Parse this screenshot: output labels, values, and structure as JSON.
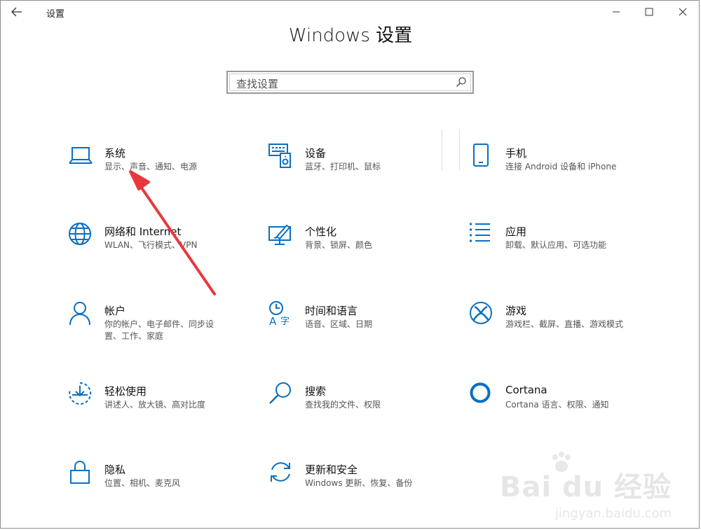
{
  "window": {
    "title": "设置"
  },
  "page": {
    "heading": "Windows 设置"
  },
  "search": {
    "placeholder": "查找设置"
  },
  "tiles": [
    {
      "id": "system",
      "title": "系统",
      "desc": "显示、声音、通知、电源"
    },
    {
      "id": "devices",
      "title": "设备",
      "desc": "蓝牙、打印机、鼠标"
    },
    {
      "id": "phone",
      "title": "手机",
      "desc": "连接 Android 设备和 iPhone"
    },
    {
      "id": "network",
      "title": "网络和 Internet",
      "desc": "WLAN、飞行模式、VPN"
    },
    {
      "id": "personalization",
      "title": "个性化",
      "desc": "背景、锁屏、颜色"
    },
    {
      "id": "apps",
      "title": "应用",
      "desc": "卸载、默认应用、可选功能"
    },
    {
      "id": "accounts",
      "title": "帐户",
      "desc": "你的帐户、电子邮件、同步设置、工作、家庭"
    },
    {
      "id": "time-language",
      "title": "时间和语言",
      "desc": "语音、区域、日期"
    },
    {
      "id": "gaming",
      "title": "游戏",
      "desc": "游戏栏、截屏、直播、游戏模式"
    },
    {
      "id": "ease-of-access",
      "title": "轻松使用",
      "desc": "讲述人、放大镜、高对比度"
    },
    {
      "id": "search",
      "title": "搜索",
      "desc": "查找我的文件、权限"
    },
    {
      "id": "cortana",
      "title": "Cortana",
      "desc": "Cortana 语言、权限、通知"
    },
    {
      "id": "privacy",
      "title": "隐私",
      "desc": "位置、相机、麦克风"
    },
    {
      "id": "update-security",
      "title": "更新和安全",
      "desc": "Windows 更新、恢复、备份"
    }
  ],
  "watermark": {
    "main": "Bai du 经验",
    "sub": "jingyan.baidu.com"
  },
  "colors": {
    "accent": "#0a6fc2",
    "annotation_arrow": "#e8383d"
  },
  "icons": {
    "back": "back-arrow-icon",
    "minimize": "minimize-icon",
    "maximize": "maximize-icon",
    "close": "close-icon",
    "search": "search-icon"
  }
}
